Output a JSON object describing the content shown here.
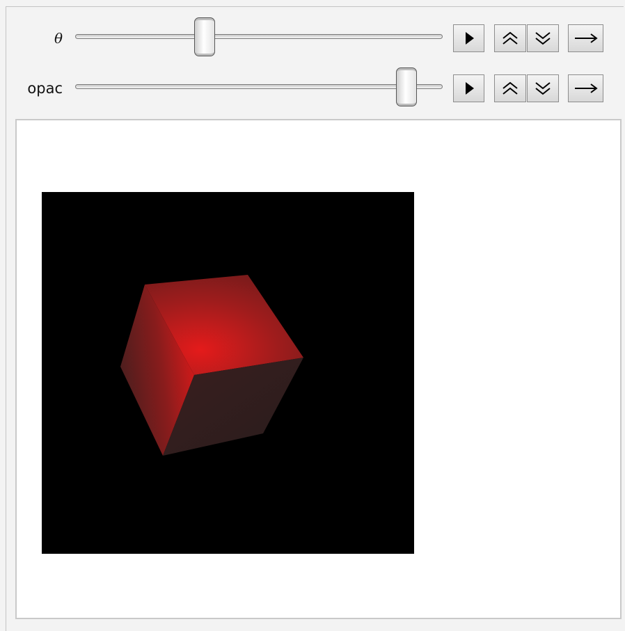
{
  "controls": [
    {
      "label": "θ",
      "label_style": "italic",
      "slider_value": 0.35
    },
    {
      "label": "opac",
      "label_style": "normal",
      "slider_value": 0.9
    }
  ],
  "buttons": {
    "play_icon": "play-icon",
    "faster_icon": "double-chevron-up-icon",
    "slower_icon": "double-chevron-down-icon",
    "direction_icon": "right-arrow-icon"
  },
  "graphic": {
    "background_color": "#000000",
    "cube_color": "#e41b1b",
    "description_shape": "cube"
  }
}
